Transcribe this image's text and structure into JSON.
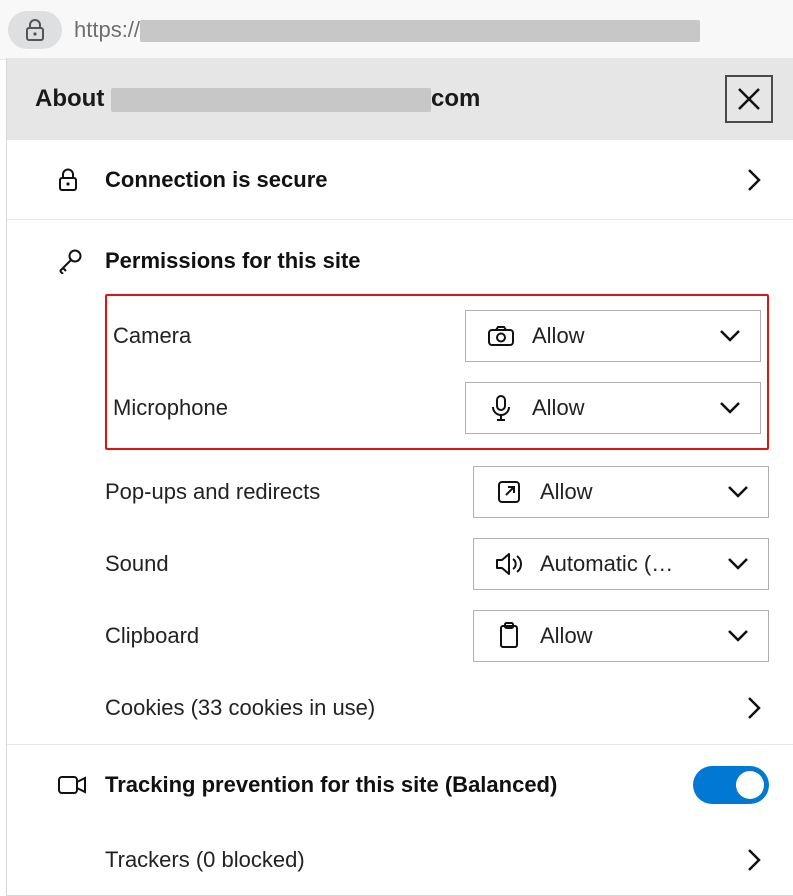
{
  "address": {
    "scheme": "https://",
    "host_blurred": "██████████████████████████████████████████"
  },
  "panel": {
    "title_prefix": "About ",
    "title_host_blurred": "███████████████████████████",
    "title_suffix": "com",
    "connection": {
      "label": "Connection is secure"
    },
    "permissions": {
      "heading": "Permissions for this site",
      "items": [
        {
          "name": "Camera",
          "value": "Allow",
          "icon": "camera",
          "highlighted": true
        },
        {
          "name": "Microphone",
          "value": "Allow",
          "icon": "mic",
          "highlighted": true
        },
        {
          "name": "Pop-ups and redirects",
          "value": "Allow",
          "icon": "popup",
          "highlighted": false
        },
        {
          "name": "Sound",
          "value": "Automatic (…",
          "icon": "sound",
          "highlighted": false
        },
        {
          "name": "Clipboard",
          "value": "Allow",
          "icon": "clipboard",
          "highlighted": false
        }
      ],
      "cookies_label": "Cookies (33 cookies in use)"
    },
    "tracking": {
      "label": "Tracking prevention for this site (Balanced)",
      "enabled": true,
      "trackers_label": "Trackers (0 blocked)"
    }
  }
}
